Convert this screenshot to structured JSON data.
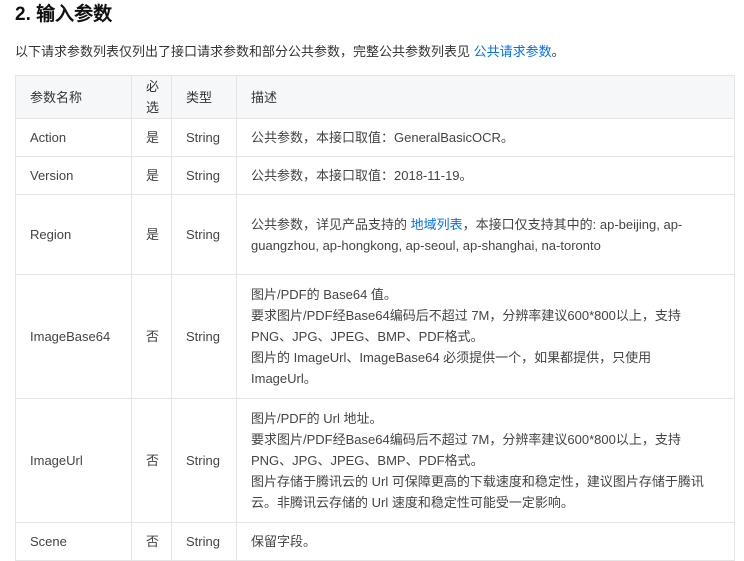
{
  "section": {
    "title": "2. 输入参数",
    "intro_text": "以下请求参数列表仅列出了接口请求参数和部分公共参数，完整公共参数列表见 ",
    "intro_link": "公共请求参数",
    "intro_end": "。"
  },
  "table": {
    "headers": [
      "参数名称",
      "必选",
      "类型",
      "描述"
    ],
    "rows": [
      {
        "name": "Action",
        "required": "是",
        "type": "String",
        "desc": [
          "公共参数，本接口取值：GeneralBasicOCR。"
        ]
      },
      {
        "name": "Version",
        "required": "是",
        "type": "String",
        "desc": [
          "公共参数，本接口取值：2018-11-19。"
        ]
      },
      {
        "name": "Region",
        "required": "是",
        "type": "String",
        "desc_pre": "公共参数，详见产品支持的 ",
        "desc_link": "地域列表",
        "desc_post": "，本接口仅支持其中的: ap-beijing, ap-guangzhou, ap-hongkong, ap-seoul, ap-shanghai, na-toronto"
      },
      {
        "name": "ImageBase64",
        "required": "否",
        "type": "String",
        "desc": [
          "图片/PDF的 Base64 值。",
          "要求图片/PDF经Base64编码后不超过 7M，分辨率建议600*800以上，支持PNG、JPG、JPEG、BMP、PDF格式。",
          "图片的 ImageUrl、ImageBase64 必须提供一个，如果都提供，只使用 ImageUrl。"
        ]
      },
      {
        "name": "ImageUrl",
        "required": "否",
        "type": "String",
        "desc": [
          "图片/PDF的 Url 地址。",
          "要求图片/PDF经Base64编码后不超过 7M，分辨率建议600*800以上，支持PNG、JPG、JPEG、BMP、PDF格式。",
          "图片存储于腾讯云的 Url 可保障更高的下载速度和稳定性，建议图片存储于腾讯云。非腾讯云存储的 Url 速度和稳定性可能受一定影响。"
        ]
      },
      {
        "name": "Scene",
        "required": "否",
        "type": "String",
        "desc": [
          "保留字段。"
        ]
      }
    ]
  }
}
